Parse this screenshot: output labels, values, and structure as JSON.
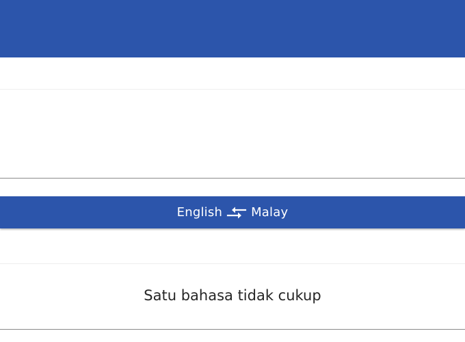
{
  "colors": {
    "header_blue": "#2c55ab",
    "lang_bar_blue": "#2c55ab",
    "divider": "#8a8a8a",
    "translation_text": "#262626"
  },
  "language_bar": {
    "source_language": "English",
    "target_language": "Malay",
    "swap_icon": "swap-arrows-icon"
  },
  "source": {
    "text": ""
  },
  "translation": {
    "text": "Satu bahasa tidak cukup"
  }
}
